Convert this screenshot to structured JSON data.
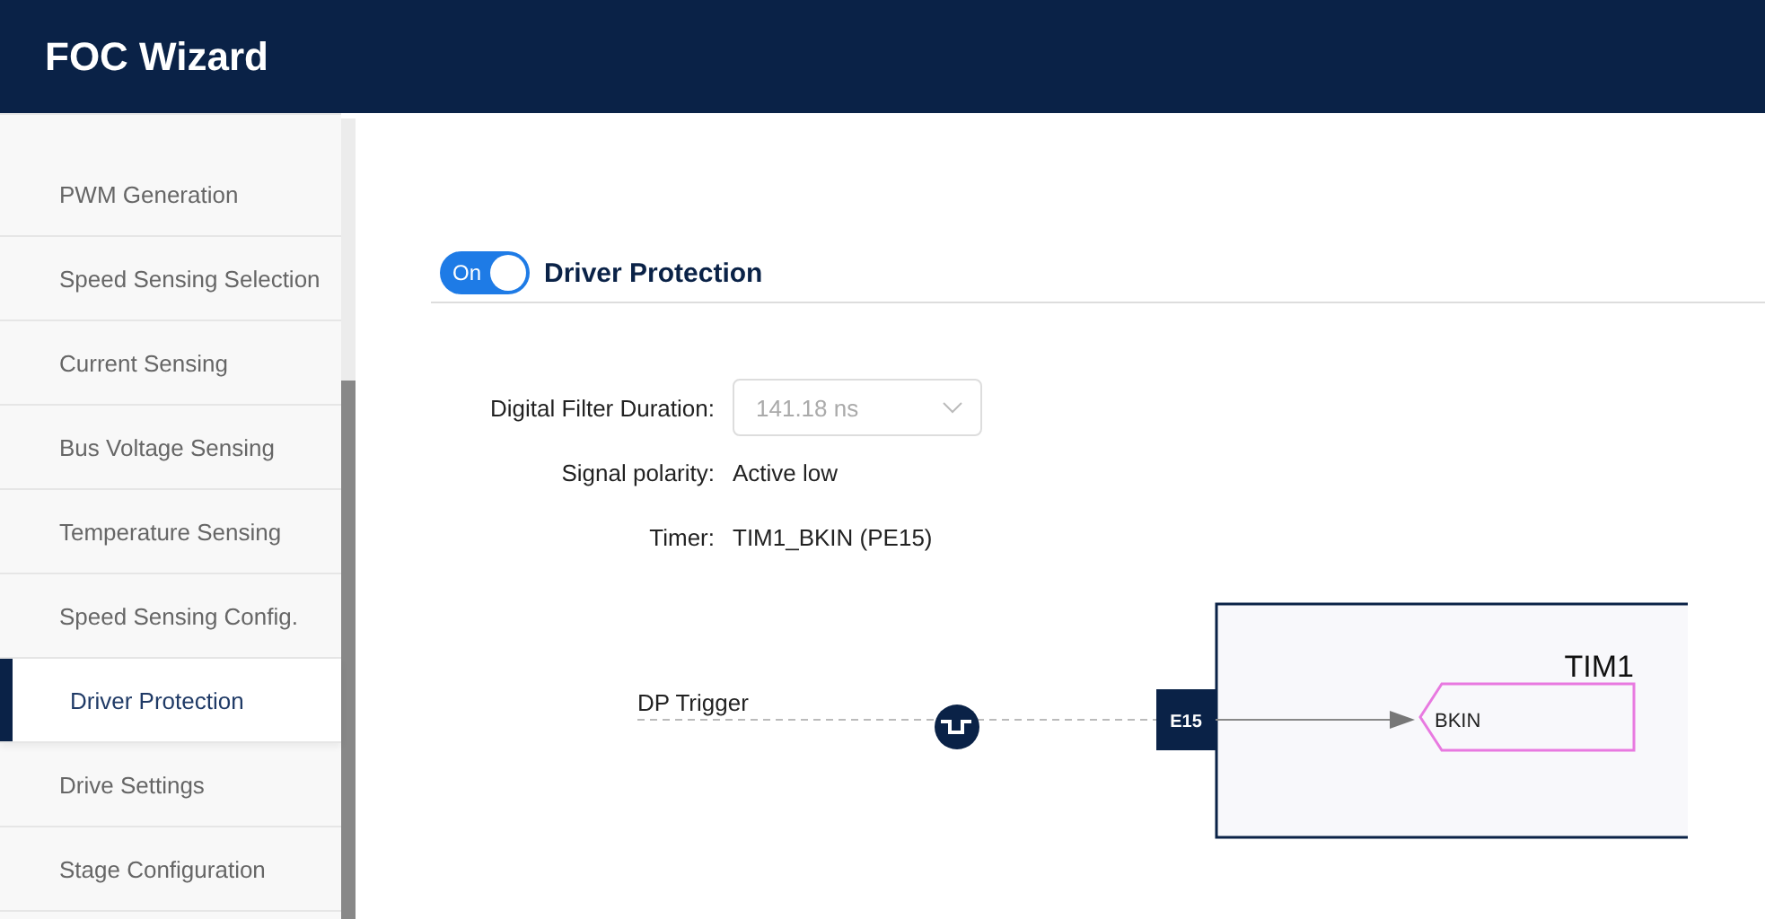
{
  "header": {
    "title": "FOC Wizard"
  },
  "sidebar": {
    "items": [
      {
        "label": "PWM Generation",
        "selected": false
      },
      {
        "label": "Speed Sensing Selection",
        "selected": false
      },
      {
        "label": "Current Sensing",
        "selected": false
      },
      {
        "label": "Bus Voltage Sensing",
        "selected": false
      },
      {
        "label": "Temperature Sensing",
        "selected": false
      },
      {
        "label": "Speed Sensing Config.",
        "selected": false
      },
      {
        "label": "Driver Protection",
        "selected": true
      },
      {
        "label": "Drive Settings",
        "selected": false
      },
      {
        "label": "Stage Configuration",
        "selected": false
      }
    ]
  },
  "section": {
    "toggle": {
      "label": "On",
      "on": true
    },
    "title": "Driver Protection"
  },
  "fields": [
    {
      "kind": "select",
      "label": "Digital Filter Duration:",
      "value": "141.18 ns",
      "disabled": true
    },
    {
      "kind": "text",
      "label": "Signal polarity:",
      "value": "Active low"
    },
    {
      "kind": "text",
      "label": "Timer:",
      "value": "TIM1_BKIN (PE15)"
    }
  ],
  "diagram": {
    "signal": "DP Trigger",
    "pin": "E15",
    "peripheral": "TIM1",
    "input": "BKIN"
  }
}
